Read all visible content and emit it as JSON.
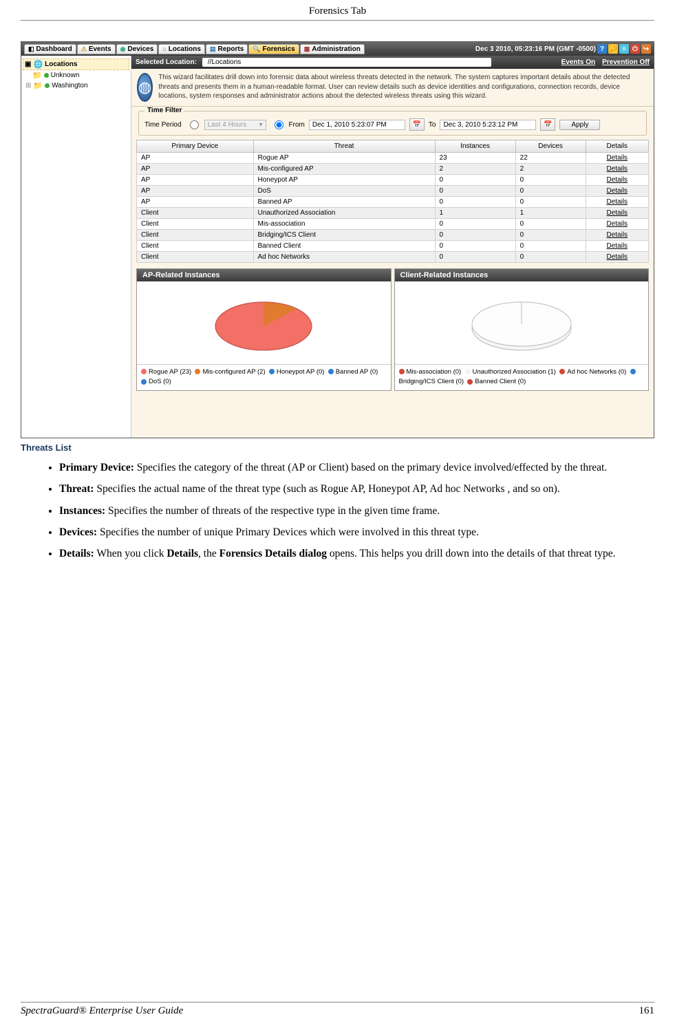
{
  "page": {
    "header": "Forensics Tab",
    "footer_title": "SpectraGuard® Enterprise User Guide",
    "footer_page": "161"
  },
  "nav": {
    "tabs": [
      "Dashboard",
      "Events",
      "Devices",
      "Locations",
      "Reports",
      "Forensics",
      "Administration"
    ],
    "active_index": 5,
    "datetime": "Dec 3 2010, 05:23:16 PM (GMT -0500)"
  },
  "sidebar": {
    "root": "Locations",
    "items": [
      "Unknown",
      "Washington"
    ]
  },
  "locbar": {
    "label": "Selected Location:",
    "path": "//Locations",
    "status1": "Events On",
    "status2": "Prevention Off"
  },
  "wizard": {
    "text": "This wizard facilitates drill down into forensic data about wireless threats detected in the network. The system captures important details about the detected threats and presents them in a human-readable format. User can review details such as device identities and configurations, connection records, device locations, system responses and administrator actions about the detected wireless threats using this wizard."
  },
  "time_filter": {
    "legend": "Time Filter",
    "label": "Time Period",
    "radio1": "Last 4 Hours",
    "radio2_from": "From",
    "from_val": "Dec 1, 2010 5:23:07 PM",
    "to_label": "To",
    "to_val": "Dec 3, 2010 5:23:12 PM",
    "apply": "Apply"
  },
  "table": {
    "headers": [
      "Primary Device",
      "Threat",
      "Instances",
      "Devices",
      "Details"
    ],
    "rows": [
      {
        "pd": "AP",
        "threat": "Rogue AP",
        "inst": "23",
        "dev": "22",
        "det": "Details"
      },
      {
        "pd": "AP",
        "threat": "Mis-configured AP",
        "inst": "2",
        "dev": "2",
        "det": "Details"
      },
      {
        "pd": "AP",
        "threat": "Honeypot AP",
        "inst": "0",
        "dev": "0",
        "det": "Details"
      },
      {
        "pd": "AP",
        "threat": "DoS",
        "inst": "0",
        "dev": "0",
        "det": "Details"
      },
      {
        "pd": "AP",
        "threat": "Banned AP",
        "inst": "0",
        "dev": "0",
        "det": "Details"
      },
      {
        "pd": "Client",
        "threat": "Unauthorized Association",
        "inst": "1",
        "dev": "1",
        "det": "Details"
      },
      {
        "pd": "Client",
        "threat": "Mis-association",
        "inst": "0",
        "dev": "0",
        "det": "Details"
      },
      {
        "pd": "Client",
        "threat": "Bridging/ICS Client",
        "inst": "0",
        "dev": "0",
        "det": "Details"
      },
      {
        "pd": "Client",
        "threat": "Banned Client",
        "inst": "0",
        "dev": "0",
        "det": "Details"
      },
      {
        "pd": "Client",
        "threat": "Ad hoc Networks",
        "inst": "0",
        "dev": "0",
        "det": "Details"
      }
    ]
  },
  "charts": {
    "ap": {
      "title": "AP-Related Instances",
      "legend": [
        {
          "label": "Rogue AP (23)",
          "color": "#f27066"
        },
        {
          "label": "Mis-configured AP (2)",
          "color": "#e07b2f"
        },
        {
          "label": "Honeypot AP (0)",
          "color": "#2f7fd1"
        },
        {
          "label": "Banned AP (0)",
          "color": "#2f7fd1"
        },
        {
          "label": "DoS (0)",
          "color": "#2f7fd1"
        }
      ]
    },
    "client": {
      "title": "Client-Related Instances",
      "legend": [
        {
          "label": "Mis-association (0)",
          "color": "#d14836"
        },
        {
          "label": "Unauthorized Association (1)",
          "color": "#f3f3f3"
        },
        {
          "label": "Ad hoc Networks (0)",
          "color": "#d14836"
        },
        {
          "label": "Bridging/ICS Client (0)",
          "color": "#2f7fd1"
        },
        {
          "label": "Banned Client (0)",
          "color": "#d14836"
        }
      ]
    }
  },
  "chart_data": [
    {
      "type": "pie",
      "title": "AP-Related Instances",
      "categories": [
        "Rogue AP",
        "Mis-configured AP",
        "Honeypot AP",
        "Banned AP",
        "DoS"
      ],
      "values": [
        23,
        2,
        0,
        0,
        0
      ]
    },
    {
      "type": "pie",
      "title": "Client-Related Instances",
      "categories": [
        "Mis-association",
        "Unauthorized Association",
        "Ad hoc Networks",
        "Bridging/ICS Client",
        "Banned Client"
      ],
      "values": [
        0,
        1,
        0,
        0,
        0
      ]
    }
  ],
  "doc": {
    "section": "Threats List",
    "items": [
      {
        "b": "Primary Device:",
        "t": " Specifies the category of the threat (AP or Client) based on the primary device involved/effected by the threat."
      },
      {
        "b": "Threat:",
        "t": " Specifies the actual name of the threat type (such as Rogue AP, Honeypot AP, Ad hoc Networks , and so on)."
      },
      {
        "b": "Instances:",
        "t": " Specifies the number of threats of the respective type in the given time frame."
      },
      {
        "b": "Devices:",
        "t": " Specifies the number of unique Primary Devices which were involved in this threat type."
      },
      {
        "b": "Details:",
        "t": " When you click ",
        "b2": "Details",
        "t2": ", the ",
        "b3": "Forensics Details dialog",
        "t3": " opens. This helps you drill down into the details of that threat type."
      }
    ]
  }
}
